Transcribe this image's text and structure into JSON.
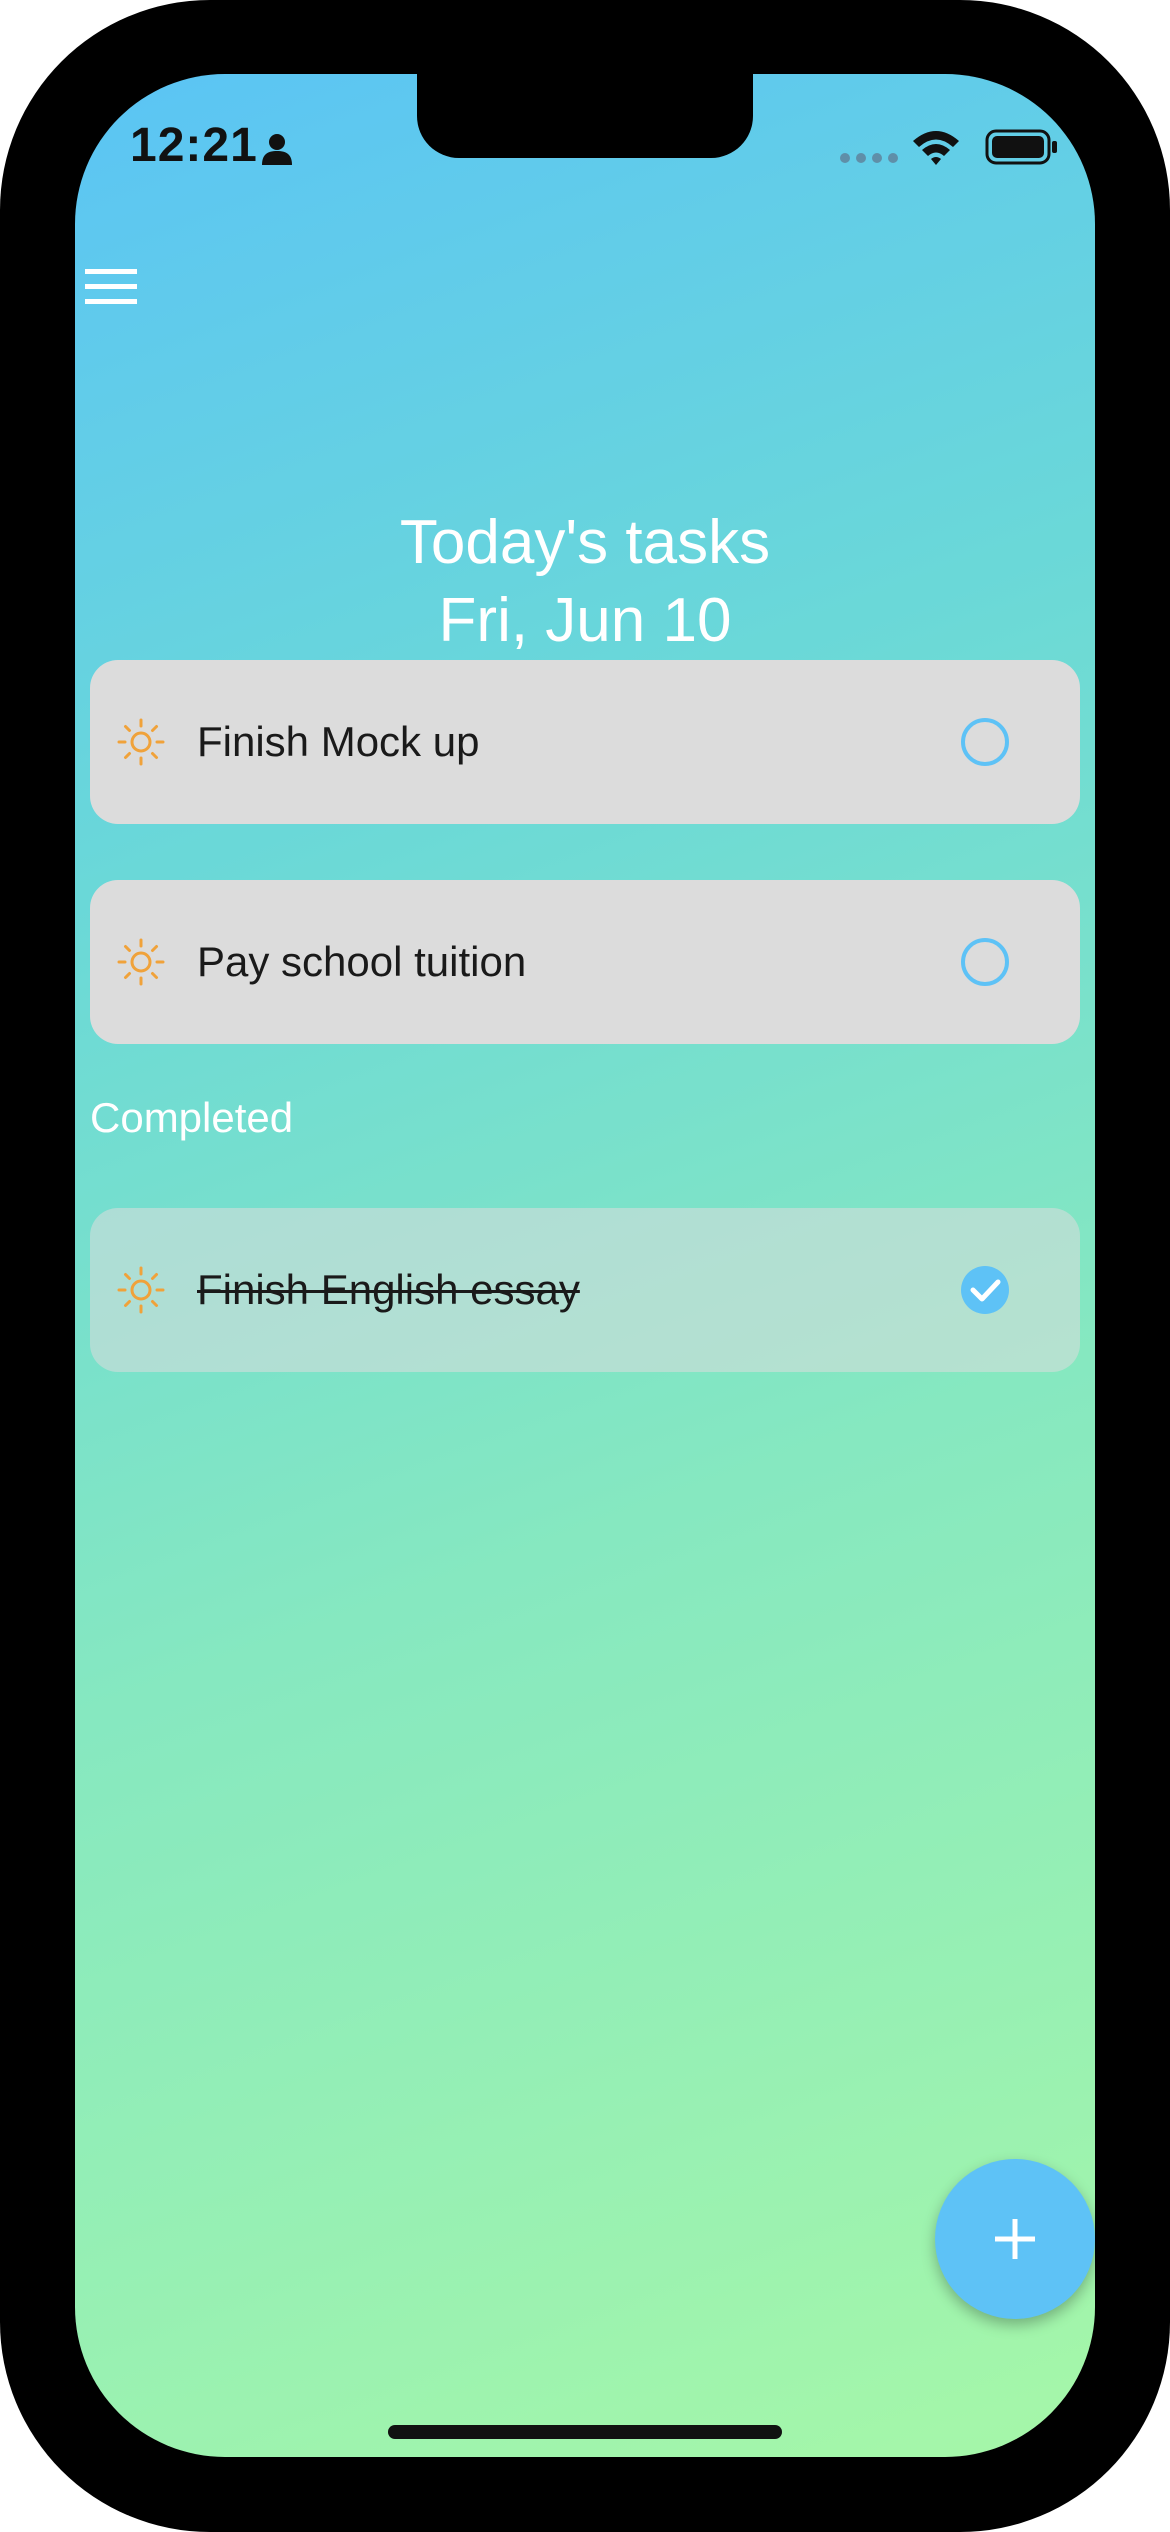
{
  "status_bar": {
    "time": "12:21",
    "person_icon": "person-icon",
    "signal_icon": "cellular-signal-icon",
    "wifi_icon": "wifi-icon",
    "battery_icon": "battery-icon"
  },
  "header": {
    "menu_icon": "hamburger-menu-icon",
    "title": "Today's tasks",
    "date": "Fri, Jun 10"
  },
  "tasks": [
    {
      "label": "Finish Mock up",
      "icon": "sun-icon",
      "completed": false
    },
    {
      "label": "Pay school tuition",
      "icon": "sun-icon",
      "completed": false
    }
  ],
  "completed_section": {
    "title": "Completed",
    "tasks": [
      {
        "label": "Finish English essay",
        "icon": "sun-icon",
        "completed": true
      }
    ]
  },
  "fab": {
    "icon": "plus-icon"
  },
  "colors": {
    "gradient_top": "#5bc4f5",
    "gradient_bottom": "#a6f7a8",
    "accent": "#5ec2f6",
    "sun": "#f0a23a",
    "card": "#dcdcdc"
  }
}
